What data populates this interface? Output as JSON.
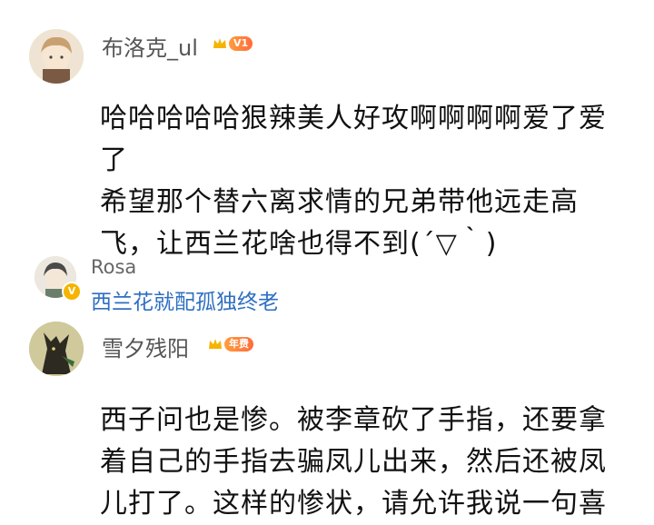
{
  "comment1": {
    "username": "布洛克_ul",
    "level_badge": "V1",
    "lines": [
      "哈哈哈哈哈狠辣美人好攻啊啊啊啊爱了爱",
      "了",
      "希望那个替六离求情的兄弟带他远走高",
      "飞，让西兰花啥也得不到(´▽｀)"
    ]
  },
  "reply": {
    "username": "Rosa",
    "verified_mark": "V",
    "text": "西兰花就配孤独终老"
  },
  "comment2": {
    "username": "雪夕残阳",
    "level_badge": "年费",
    "lines": [
      "西子问也是惨。被李章砍了手指，还要拿",
      "着自己的手指去骗凤儿出来，然后还被凤",
      "儿打了。这样的惨状，请允许我说一句喜"
    ]
  },
  "colors": {
    "username": "#555555",
    "reply_text": "#2e6fc2",
    "badge": "#ff7a3d",
    "crown": "#f5b400"
  }
}
